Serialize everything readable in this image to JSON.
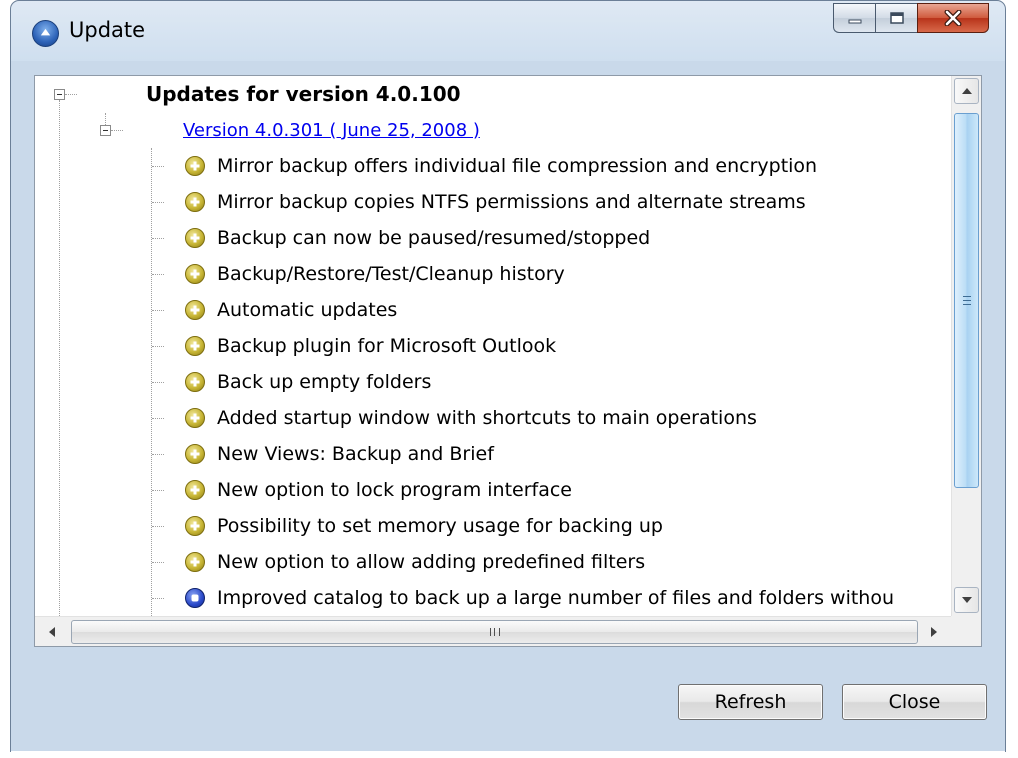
{
  "window": {
    "title": "Update",
    "icon": "app-update-icon",
    "caption_buttons": [
      "minimize-icon",
      "maximize-icon",
      "close-icon"
    ]
  },
  "tree": {
    "root": {
      "label": "Updates for version 4.0.100",
      "expanded": true
    },
    "version": {
      "label": "Version 4.0.301 ( June 25, 2008 )",
      "expanded": true
    },
    "items": [
      {
        "label": "Mirror backup offers individual file compression and encryption",
        "icon": "new-feature-icon"
      },
      {
        "label": "Mirror backup copies NTFS permissions and alternate streams",
        "icon": "new-feature-icon"
      },
      {
        "label": "Backup can now be paused/resumed/stopped",
        "icon": "new-feature-icon"
      },
      {
        "label": "Backup/Restore/Test/Cleanup history",
        "icon": "new-feature-icon"
      },
      {
        "label": "Automatic updates",
        "icon": "new-feature-icon"
      },
      {
        "label": "Backup plugin for Microsoft Outlook",
        "icon": "new-feature-icon"
      },
      {
        "label": "Back up empty folders",
        "icon": "new-feature-icon"
      },
      {
        "label": "Added startup window with shortcuts to main operations",
        "icon": "new-feature-icon"
      },
      {
        "label": "New Views: Backup and Brief",
        "icon": "new-feature-icon"
      },
      {
        "label": "New option to lock program interface",
        "icon": "new-feature-icon"
      },
      {
        "label": "Possibility to set memory usage for backing up",
        "icon": "new-feature-icon"
      },
      {
        "label": "New option to allow adding predefined filters",
        "icon": "new-feature-icon"
      },
      {
        "label": "Improved catalog to back up a large number of files and folders withou",
        "icon": "improvement-icon"
      }
    ]
  },
  "buttons": {
    "refresh": "Refresh",
    "close": "Close"
  },
  "colors": {
    "link": "#0000ee",
    "new_feature_icon": "#c8b636",
    "improvement_icon": "#2a49c9",
    "frame": "#c9d9ea"
  }
}
